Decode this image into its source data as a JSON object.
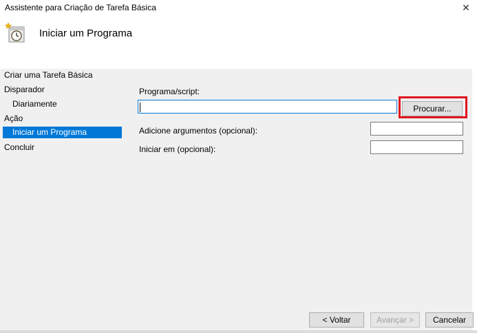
{
  "window": {
    "title": "Assistente para Criação de Tarefa Básica",
    "close_glyph": "✕"
  },
  "header": {
    "icon": "task-scheduler-clock-icon",
    "title": "Iniciar um Programa"
  },
  "nav": {
    "items": [
      {
        "label": "Criar uma Tarefa Básica",
        "selected": false
      },
      {
        "label": "Disparador",
        "selected": false
      },
      {
        "label": "Diariamente",
        "selected": false
      },
      {
        "label": "Ação",
        "selected": false
      },
      {
        "label": "Iniciar um Programa",
        "selected": true
      },
      {
        "label": "Concluir",
        "selected": false
      }
    ]
  },
  "form": {
    "program_label": "Programa/script:",
    "program_value": "",
    "browse_label": "Procurar...",
    "args_label": "Adicione argumentos (opcional):",
    "args_value": "",
    "start_in_label": "Iniciar em (opcional):",
    "start_in_value": ""
  },
  "footer": {
    "back_label": "< Voltar",
    "next_label": "Avançar >",
    "cancel_label": "Cancelar"
  },
  "colors": {
    "selection": "#0078d7",
    "highlight_box": "#e0141c",
    "content_bg": "#f0f0f0"
  }
}
